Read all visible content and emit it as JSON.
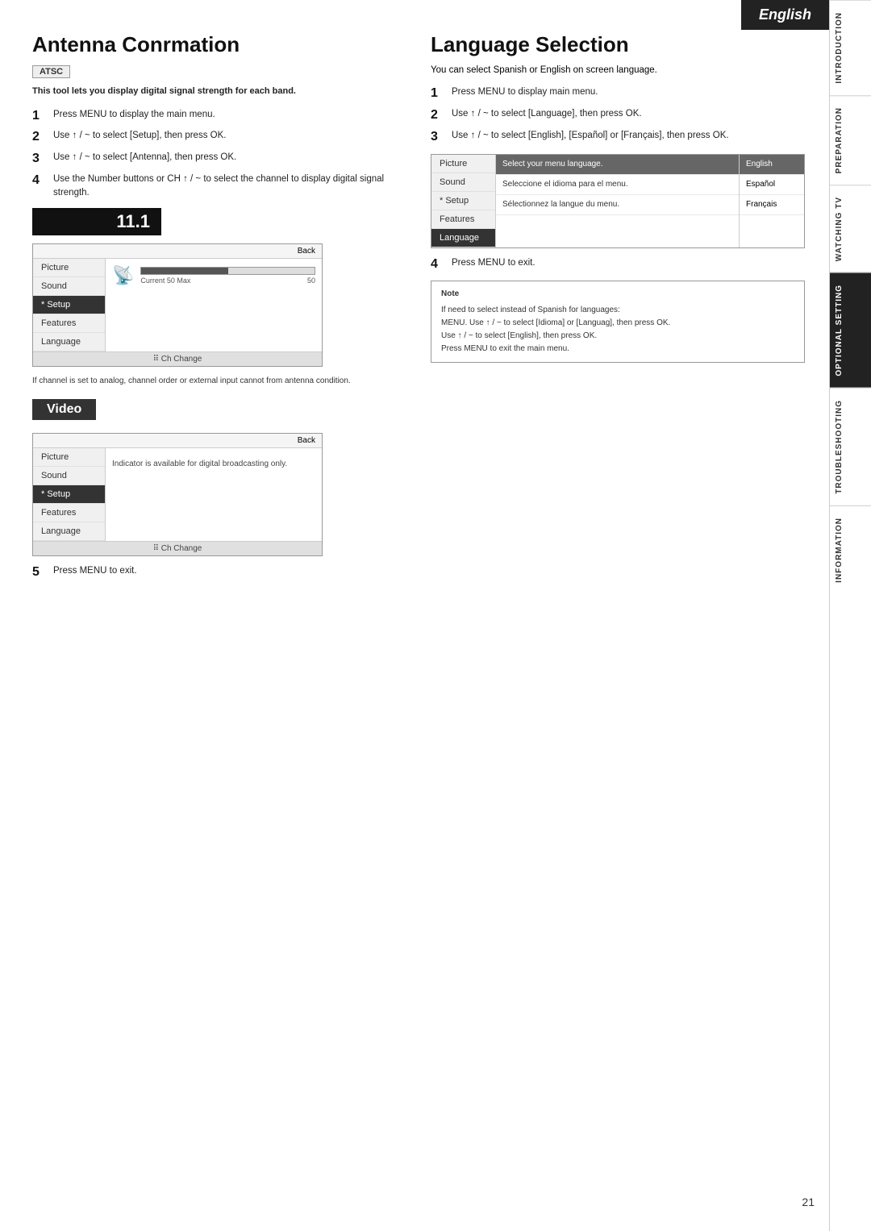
{
  "page": {
    "number": "21",
    "language_badge": "English"
  },
  "sidebar": {
    "tabs": [
      {
        "id": "introduction",
        "label": "INTRODUCTION",
        "active": false
      },
      {
        "id": "preparation",
        "label": "PREPARATION",
        "active": false
      },
      {
        "id": "watching-tv",
        "label": "WATCHING TV",
        "active": false
      },
      {
        "id": "optional-setting",
        "label": "OPTIONAL SETTING",
        "active": true
      },
      {
        "id": "troubleshooting",
        "label": "TROUBLESHOOTING",
        "active": false
      },
      {
        "id": "information",
        "label": "INFORMATION",
        "active": false
      }
    ]
  },
  "antenna_section": {
    "title": "Antenna Conrmation",
    "badge": "ATSC",
    "subtitle": "This tool lets you display digital signal strength for each band.",
    "steps": [
      {
        "num": "1",
        "text": "Press MENU to display the main menu."
      },
      {
        "num": "2",
        "text": "Use ↑ / ~ to select [Setup], then press OK."
      },
      {
        "num": "3",
        "text": "Use ↑ / ~ to select [Antenna], then press OK."
      },
      {
        "num": "4",
        "text": "Use the Number buttons or CH ↑ / ~ to select the channel to display digital signal strength."
      }
    ],
    "channel_display": "11.1",
    "menu1": {
      "items": [
        "Picture",
        "Sound",
        "* Setup",
        "Features",
        "Language"
      ],
      "selected": "* Setup",
      "back_label": "Back",
      "footer": "Ch Change",
      "signal_label": "Current 50 Max",
      "signal_value": "50"
    },
    "note_text": "If channel is set to analog, channel order or external input cannot from antenna condition.",
    "video_label": "Video",
    "menu2": {
      "items": [
        "Picture",
        "Sound",
        "* Setup",
        "Features",
        "Language"
      ],
      "selected": "* Setup",
      "back_label": "Back",
      "footer": "Ch Change",
      "digital_note": "Indicator is available for digital broadcasting only."
    },
    "step5": {
      "num": "5",
      "text": "Press MENU to exit."
    }
  },
  "language_section": {
    "title": "Language Selection",
    "intro": "You can select Spanish or English on screen language.",
    "steps": [
      {
        "num": "1",
        "text": "Press MENU to display main menu."
      },
      {
        "num": "2",
        "text": "Use ↑ / ~ to select [Language], then press OK."
      },
      {
        "num": "3",
        "text": "Use ↑ / ~ to select [English], [Español] or [Français], then press OK."
      }
    ],
    "menu": {
      "items": [
        "Picture",
        "Sound",
        "* Setup",
        "Features",
        "Language"
      ],
      "selected": "Language",
      "options": [
        {
          "label": "Select your menu language.",
          "value": "English",
          "highlighted": true
        },
        {
          "label": "Seleccione el idioma para el menu.",
          "value": "Español"
        },
        {
          "label": "Sélectionnez la langue du menu.",
          "value": "Français"
        }
      ]
    },
    "step4": {
      "num": "4",
      "text": "Press MENU to exit."
    },
    "note": {
      "title": "Note",
      "lines": [
        "If need to select instead of Spanish for languages:",
        "MENU. Use ↑ / ~ to select [Idioma] or [Languag], then press OK.",
        "Use ↑ / ~ to select [English], then press OK.",
        "Press MENU to exit the main menu."
      ]
    }
  }
}
